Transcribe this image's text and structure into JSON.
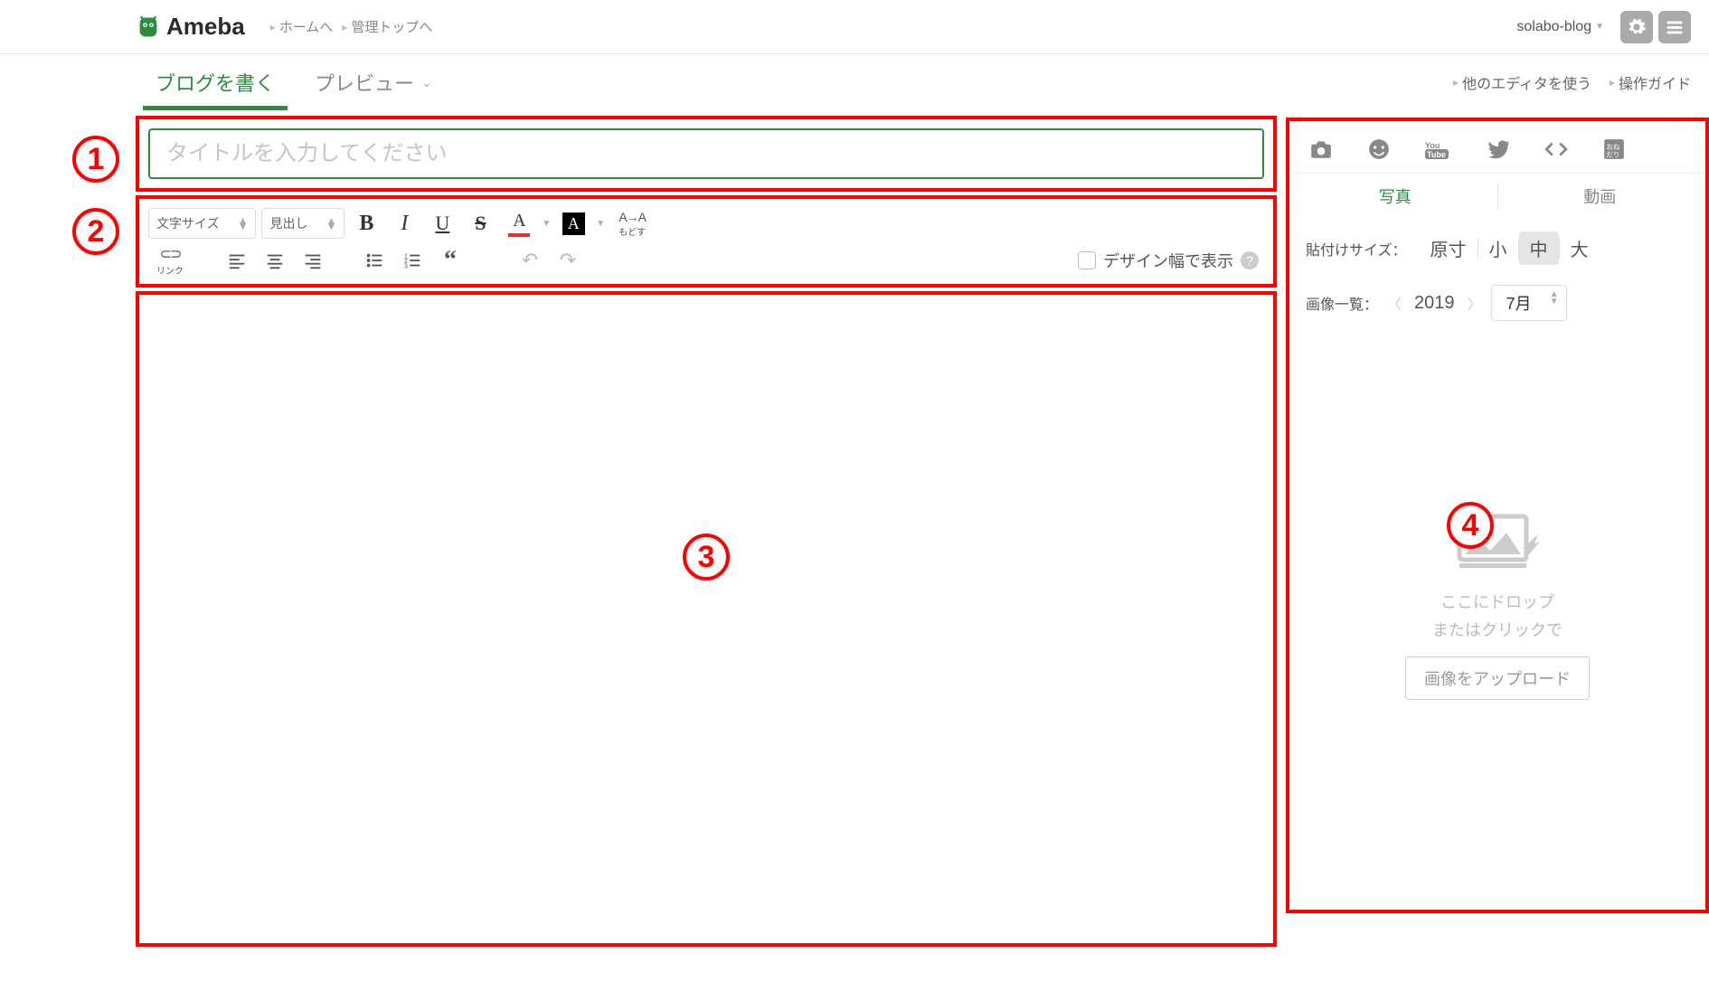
{
  "header": {
    "logo": "Ameba",
    "link_home": "ホームへ",
    "link_admin": "管理トップへ",
    "username": "solabo-blog"
  },
  "subnav": {
    "tab_write": "ブログを書く",
    "tab_preview": "プレビュー",
    "link_other_editor": "他のエディタを使う",
    "link_guide": "操作ガイド"
  },
  "title_input": {
    "placeholder": "タイトルを入力してください",
    "value": ""
  },
  "toolbar": {
    "font_size": "文字サイズ",
    "heading": "見出し",
    "bold": "B",
    "italic": "I",
    "underline": "U",
    "strike": "S",
    "fg_a": "A",
    "bg_a": "A",
    "reset_top": "A→A",
    "reset_label": "もどす",
    "link_icon": "⊂⊃",
    "link_label": "リンク",
    "design_width": "デザイン幅で表示",
    "help": "?"
  },
  "right_panel": {
    "tabs": {
      "photo": "写真",
      "video": "動画"
    },
    "paste_size_label": "貼付けサイズ：",
    "sizes": {
      "original": "原寸",
      "small": "小",
      "medium": "中",
      "large": "大"
    },
    "gallery_label": "画像一覧：",
    "year": "2019",
    "month": "7月",
    "dropzone_line1": "ここにドロップ",
    "dropzone_line2": "またはクリックで",
    "upload_button": "画像をアップロード"
  },
  "annotations": {
    "a1": "1",
    "a2": "2",
    "a3": "3",
    "a4": "4"
  }
}
